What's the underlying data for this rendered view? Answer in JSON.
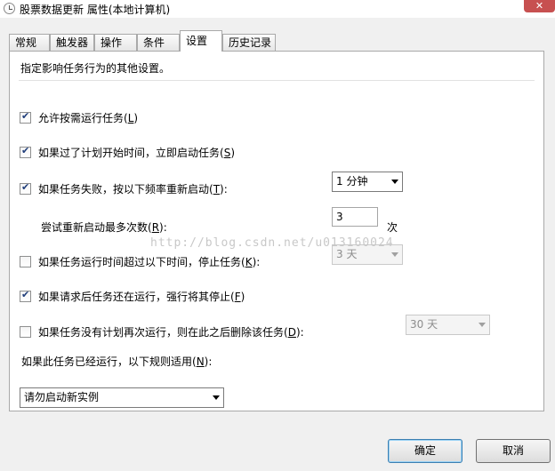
{
  "window": {
    "title": "股票数据更新 属性(本地计算机)",
    "close_symbol": "✕"
  },
  "tabs": [
    {
      "label": "常规",
      "active": false
    },
    {
      "label": "触发器",
      "active": false
    },
    {
      "label": "操作",
      "active": false
    },
    {
      "label": "条件",
      "active": false
    },
    {
      "label": "设置",
      "active": true
    },
    {
      "label": "历史记录",
      "active": false
    }
  ],
  "settings": {
    "description": "指定影响任务行为的其他设置。",
    "allow_on_demand": {
      "text": "允许按需运行任务(",
      "key": "L",
      "close": ")",
      "checked": true
    },
    "run_if_missed": {
      "text": "如果过了计划开始时间，立即启动任务(",
      "key": "S",
      "close": ")",
      "checked": true
    },
    "restart_on_fail": {
      "text": "如果任务失败，按以下频率重新启动(",
      "key": "T",
      "close": "):",
      "checked": true
    },
    "restart_interval": "1 分钟",
    "retry_label": {
      "text": "尝试重新启动最多次数(",
      "key": "R",
      "close": "):"
    },
    "retry_count": "3",
    "retry_unit": "次",
    "stop_if_longer": {
      "text": "如果任务运行时间超过以下时间，停止任务(",
      "key": "K",
      "close": "):",
      "checked": false
    },
    "stop_duration": "3 天",
    "force_stop": {
      "text": "如果请求后任务还在运行，强行将其停止(",
      "key": "F",
      "close": ")",
      "checked": true
    },
    "delete_if_not_scheduled": {
      "text": "如果任务没有计划再次运行，则在此之后删除该任务(",
      "key": "D",
      "close": "):",
      "checked": false
    },
    "delete_after": "30 天",
    "already_running_label": {
      "text": "如果此任务已经运行，以下规则适用(",
      "key": "N",
      "close": "):"
    },
    "already_running_rule": "请勿启动新实例"
  },
  "watermark": "http://blog.csdn.net/u013160024",
  "buttons": {
    "ok": "确定",
    "cancel": "取消"
  }
}
